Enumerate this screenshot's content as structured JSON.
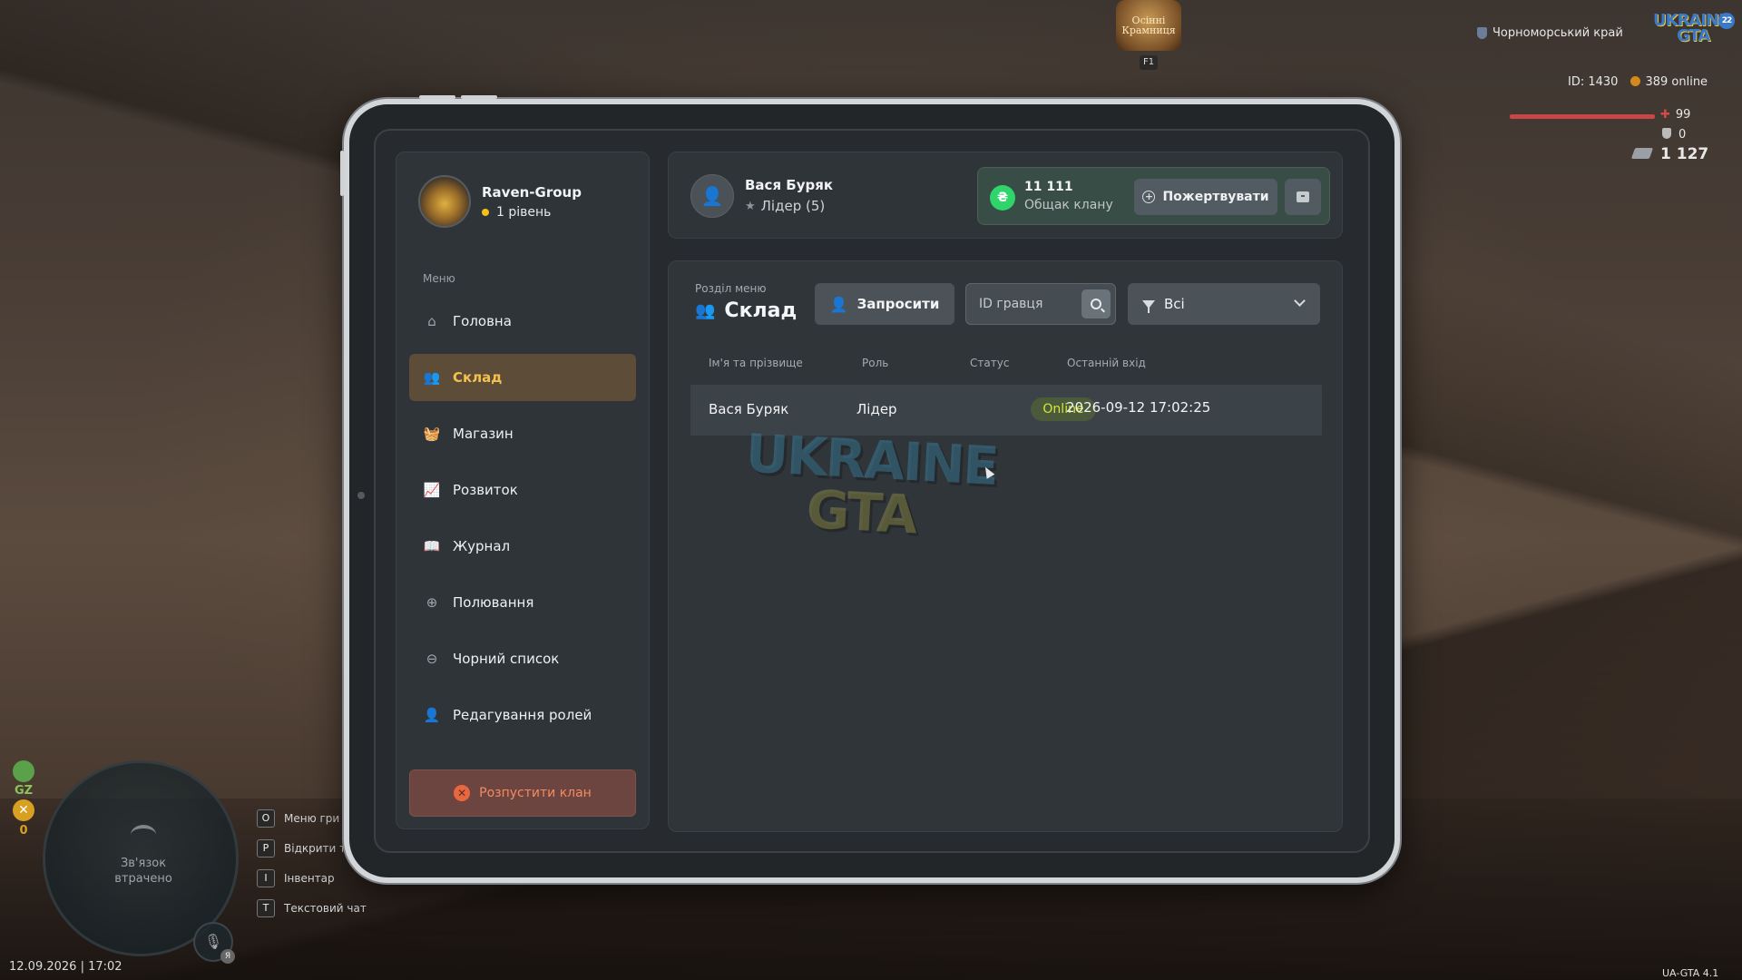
{
  "hud": {
    "shop_label": "Осінні Крамниця",
    "shop_key": "F1",
    "region": "Чорноморський край",
    "logo_text_1": "UKRAINE",
    "logo_text_2": "GTA",
    "logo_badge": "22",
    "id_label": "ID: 1430",
    "online_label": "389 online",
    "health": "99",
    "armor": "0",
    "money": "1 127",
    "gz_label": "GZ",
    "x_label": "✕",
    "zero_label": "0",
    "minimap_text_1": "Зв'язок",
    "minimap_text_2": "втрачено",
    "mic_badge": "Я",
    "keyhints": [
      {
        "key": "O",
        "label": "Меню гри"
      },
      {
        "key": "P",
        "label": "Відкрити т"
      },
      {
        "key": "I",
        "label": "Інвентар"
      },
      {
        "key": "T",
        "label": "Текстовий чат"
      }
    ],
    "datetime": "12.09.2026 | 17:02",
    "version": "UA-GTA 4.1"
  },
  "clan": {
    "name": "Raven-Group",
    "level": "1 рівень"
  },
  "menu": {
    "caption": "Меню",
    "items": [
      {
        "label": "Головна",
        "icon": "home-icon",
        "glyph": "⌂"
      },
      {
        "label": "Склад",
        "icon": "people-icon",
        "glyph": "👥"
      },
      {
        "label": "Магазин",
        "icon": "basket-icon",
        "glyph": "🧺"
      },
      {
        "label": "Розвиток",
        "icon": "chart-icon",
        "glyph": "📈"
      },
      {
        "label": "Журнал",
        "icon": "book-icon",
        "glyph": "📖"
      },
      {
        "label": "Полювання",
        "icon": "crosshair-icon",
        "glyph": "⊕"
      },
      {
        "label": "Чорний список",
        "icon": "block-icon",
        "glyph": "⊖"
      },
      {
        "label": "Редагування ролей",
        "icon": "user-edit-icon",
        "glyph": "👤"
      }
    ],
    "active_index": 1,
    "disband_label": "Розпустити клан"
  },
  "profile": {
    "name": "Вася Буряк",
    "role": "Лідер (5)",
    "balance": "11 111",
    "balance_label": "Общак клану",
    "coin_symbol": "₴",
    "donate_label": "Пожертвувати"
  },
  "main": {
    "caption": "Розділ меню",
    "title": "Склад",
    "invite_label": "Запросити",
    "search_placeholder": "ID гравця",
    "filter_value": "Всі",
    "columns": [
      "Ім'я та прізвище",
      "Роль",
      "Статус",
      "Останній вхід"
    ],
    "rows": [
      {
        "name": "Вася Буряк",
        "role": "Лідер",
        "status": "Online",
        "last_login": "2026-09-12 17:02:25"
      }
    ],
    "watermark_1": "UKRAINE",
    "watermark_2": "GTA"
  },
  "colors": {
    "accent_active": "#f2c14e",
    "status_online": "#d6e63a",
    "danger": "#e9673f",
    "coin_green": "#2fd46a"
  }
}
